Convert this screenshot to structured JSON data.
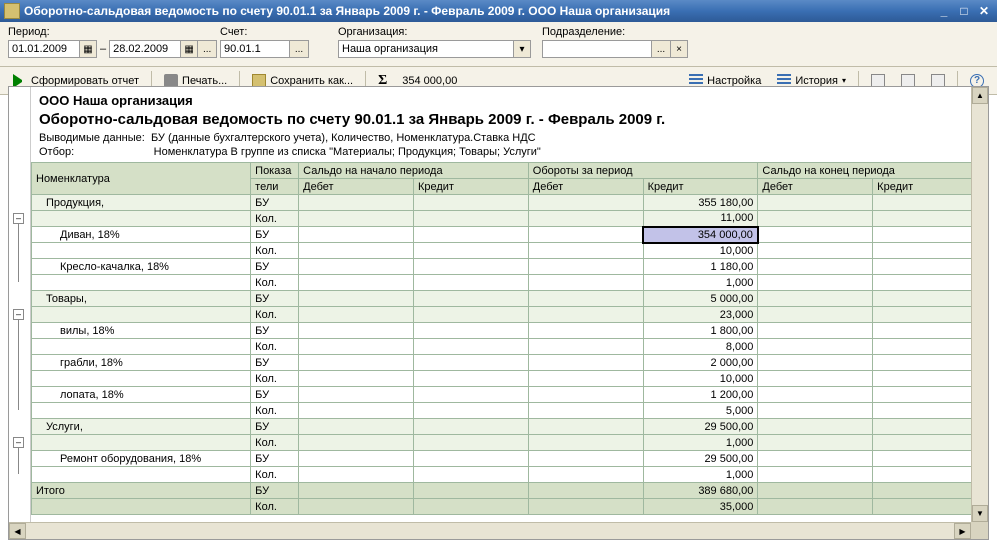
{
  "window": {
    "title": "Оборотно-сальдовая ведомость по счету 90.01.1 за Январь 2009 г. - Февраль 2009 г. ООО Наша организация"
  },
  "params": {
    "period_label": "Период:",
    "date_from": "01.01.2009",
    "date_to": "28.02.2009",
    "account_label": "Счет:",
    "account": "90.01.1",
    "org_label": "Организация:",
    "organization": "Наша организация",
    "subdiv_label": "Подразделение:",
    "subdivision": ""
  },
  "toolbar": {
    "run": "Сформировать отчет",
    "print": "Печать...",
    "save": "Сохранить как...",
    "sum_value": "354 000,00",
    "settings": "Настройка",
    "history": "История"
  },
  "report": {
    "org": "ООО Наша организация",
    "title": "Оборотно-сальдовая ведомость по счету 90.01.1 за Январь 2009 г. - Февраль 2009 г.",
    "meta1_label": "Выводимые данные:",
    "meta1_val": "БУ (данные бухгалтерского учета), Количество, Номенклатура.Ставка НДС",
    "meta2_label": "Отбор:",
    "meta2_val": "Номенклатура В группе из списка \"Материалы; Продукция; Товары; Услуги\""
  },
  "headers": {
    "nomen": "Номенклатура",
    "pok": "Показа",
    "pok2": "тели",
    "open": "Сальдо на начало периода",
    "turn": "Обороты за период",
    "close": "Сальдо на конец периода",
    "debit": "Дебет",
    "credit": "Кредит"
  },
  "rows": [
    {
      "type": "grp",
      "indent": 1,
      "name": "Продукция,",
      "pok": "БУ",
      "open_d": "",
      "open_c": "",
      "turn_d": "",
      "turn_c": "355 180,00",
      "close_d": "",
      "close_c": ""
    },
    {
      "type": "grp",
      "indent": 1,
      "name": "",
      "pok": "Кол.",
      "open_d": "",
      "open_c": "",
      "turn_d": "",
      "turn_c": "11,000",
      "close_d": "",
      "close_c": ""
    },
    {
      "type": "row",
      "indent": 2,
      "name": "Диван, 18%",
      "pok": "БУ",
      "open_d": "",
      "open_c": "",
      "turn_d": "",
      "turn_c": "354 000,00",
      "close_d": "",
      "close_c": "",
      "hilite": true
    },
    {
      "type": "row",
      "indent": 2,
      "name": "",
      "pok": "Кол.",
      "open_d": "",
      "open_c": "",
      "turn_d": "",
      "turn_c": "10,000",
      "close_d": "",
      "close_c": ""
    },
    {
      "type": "row",
      "indent": 2,
      "name": "Кресло-качалка, 18%",
      "pok": "БУ",
      "open_d": "",
      "open_c": "",
      "turn_d": "",
      "turn_c": "1 180,00",
      "close_d": "",
      "close_c": ""
    },
    {
      "type": "row",
      "indent": 2,
      "name": "",
      "pok": "Кол.",
      "open_d": "",
      "open_c": "",
      "turn_d": "",
      "turn_c": "1,000",
      "close_d": "",
      "close_c": ""
    },
    {
      "type": "grp",
      "indent": 1,
      "name": "Товары,",
      "pok": "БУ",
      "open_d": "",
      "open_c": "",
      "turn_d": "",
      "turn_c": "5 000,00",
      "close_d": "",
      "close_c": ""
    },
    {
      "type": "grp",
      "indent": 1,
      "name": "",
      "pok": "Кол.",
      "open_d": "",
      "open_c": "",
      "turn_d": "",
      "turn_c": "23,000",
      "close_d": "",
      "close_c": ""
    },
    {
      "type": "row",
      "indent": 2,
      "name": "вилы, 18%",
      "pok": "БУ",
      "open_d": "",
      "open_c": "",
      "turn_d": "",
      "turn_c": "1 800,00",
      "close_d": "",
      "close_c": ""
    },
    {
      "type": "row",
      "indent": 2,
      "name": "",
      "pok": "Кол.",
      "open_d": "",
      "open_c": "",
      "turn_d": "",
      "turn_c": "8,000",
      "close_d": "",
      "close_c": ""
    },
    {
      "type": "row",
      "indent": 2,
      "name": "грабли, 18%",
      "pok": "БУ",
      "open_d": "",
      "open_c": "",
      "turn_d": "",
      "turn_c": "2 000,00",
      "close_d": "",
      "close_c": ""
    },
    {
      "type": "row",
      "indent": 2,
      "name": "",
      "pok": "Кол.",
      "open_d": "",
      "open_c": "",
      "turn_d": "",
      "turn_c": "10,000",
      "close_d": "",
      "close_c": ""
    },
    {
      "type": "row",
      "indent": 2,
      "name": "лопата, 18%",
      "pok": "БУ",
      "open_d": "",
      "open_c": "",
      "turn_d": "",
      "turn_c": "1 200,00",
      "close_d": "",
      "close_c": ""
    },
    {
      "type": "row",
      "indent": 2,
      "name": "",
      "pok": "Кол.",
      "open_d": "",
      "open_c": "",
      "turn_d": "",
      "turn_c": "5,000",
      "close_d": "",
      "close_c": ""
    },
    {
      "type": "grp",
      "indent": 1,
      "name": "Услуги,",
      "pok": "БУ",
      "open_d": "",
      "open_c": "",
      "turn_d": "",
      "turn_c": "29 500,00",
      "close_d": "",
      "close_c": ""
    },
    {
      "type": "grp",
      "indent": 1,
      "name": "",
      "pok": "Кол.",
      "open_d": "",
      "open_c": "",
      "turn_d": "",
      "turn_c": "1,000",
      "close_d": "",
      "close_c": ""
    },
    {
      "type": "row",
      "indent": 2,
      "name": "Ремонт оборудования, 18%",
      "pok": "БУ",
      "open_d": "",
      "open_c": "",
      "turn_d": "",
      "turn_c": "29 500,00",
      "close_d": "",
      "close_c": ""
    },
    {
      "type": "row",
      "indent": 2,
      "name": "",
      "pok": "Кол.",
      "open_d": "",
      "open_c": "",
      "turn_d": "",
      "turn_c": "1,000",
      "close_d": "",
      "close_c": ""
    },
    {
      "type": "tot",
      "indent": 0,
      "name": "Итого",
      "pok": "БУ",
      "open_d": "",
      "open_c": "",
      "turn_d": "",
      "turn_c": "389 680,00",
      "close_d": "",
      "close_c": ""
    },
    {
      "type": "tot",
      "indent": 0,
      "name": "",
      "pok": "Кол.",
      "open_d": "",
      "open_c": "",
      "turn_d": "",
      "turn_c": "35,000",
      "close_d": "",
      "close_c": ""
    }
  ]
}
